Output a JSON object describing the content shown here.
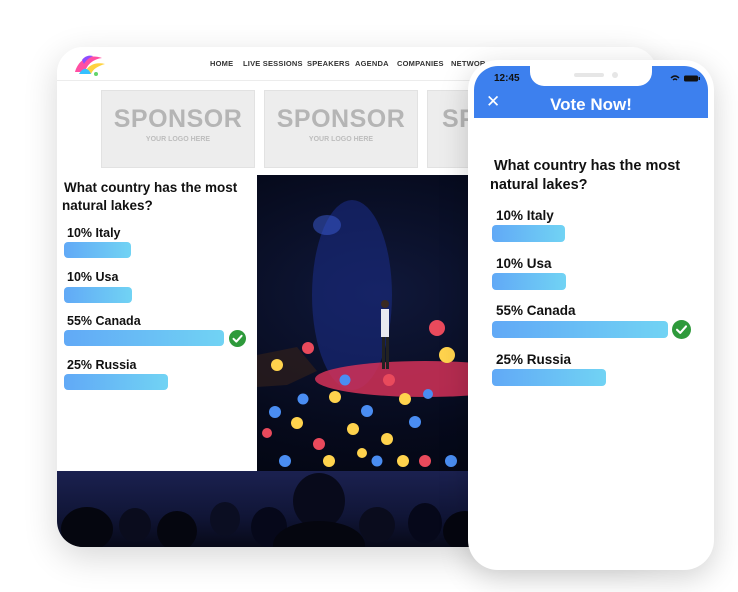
{
  "website": {
    "nav": [
      "HOME",
      "LIVE SESSIONS",
      "SPEAKERS",
      "AGENDA",
      "COMPANIES",
      "NETWOR"
    ],
    "sponsors": [
      {
        "title": "SPONSOR",
        "subtitle": "YOUR LOGO HERE"
      },
      {
        "title": "SPONSOR",
        "subtitle": "YOUR LOGO HERE"
      },
      {
        "title": "SP",
        "subtitle": ""
      }
    ]
  },
  "poll": {
    "question_line1": "What country has the most",
    "question_line2": "natural lakes?",
    "options": [
      {
        "label": "10% Italy",
        "percent": 10,
        "correct": false
      },
      {
        "label": "10% Usa",
        "percent": 10,
        "correct": false
      },
      {
        "label": "55% Canada",
        "percent": 55,
        "correct": true
      },
      {
        "label": "25% Russia",
        "percent": 25,
        "correct": false
      }
    ]
  },
  "phone": {
    "time": "12:45",
    "title": "Vote Now!",
    "close_icon": "close-icon"
  },
  "colors": {
    "accent": "#3d80ee",
    "bar_start": "#61a9f6",
    "bar_end": "#71d3f4",
    "check": "#2e9a3b"
  }
}
